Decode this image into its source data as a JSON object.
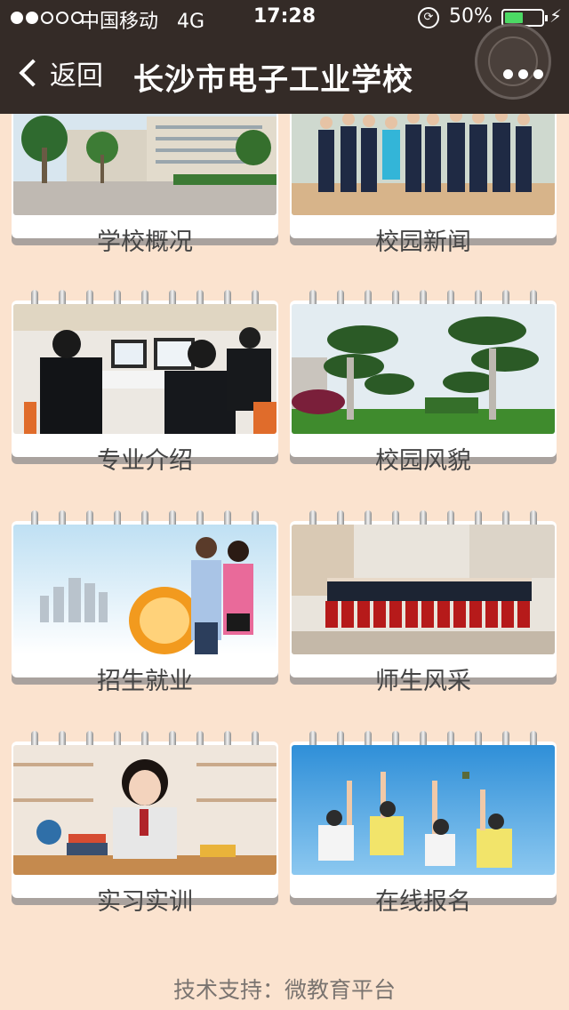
{
  "status_bar": {
    "carrier": "中国移动",
    "network": "4G",
    "time": "17:28",
    "battery_percent": "50%",
    "battery_level": 0.5
  },
  "nav": {
    "back_label": "返回",
    "title": "长沙市电子工业学校"
  },
  "menu": [
    {
      "label": "学校概况",
      "image": "campus-building-photo"
    },
    {
      "label": "校园新闻",
      "image": "group-visitors-photo"
    },
    {
      "label": "专业介绍",
      "image": "computer-lab-photo"
    },
    {
      "label": "校园风貌",
      "image": "campus-trees-photo"
    },
    {
      "label": "招生就业",
      "image": "students-globe-photo"
    },
    {
      "label": "师生风采",
      "image": "student-group-banner-photo"
    },
    {
      "label": "实习实训",
      "image": "girl-studying-photo"
    },
    {
      "label": "在线报名",
      "image": "graduates-sky-photo"
    }
  ],
  "footer": "技术支持：微教育平台",
  "colors": {
    "background": "#fbe3cf",
    "topbar": "#342b27",
    "card_shadow": "#a9a29e",
    "battery": "#4cd964"
  }
}
